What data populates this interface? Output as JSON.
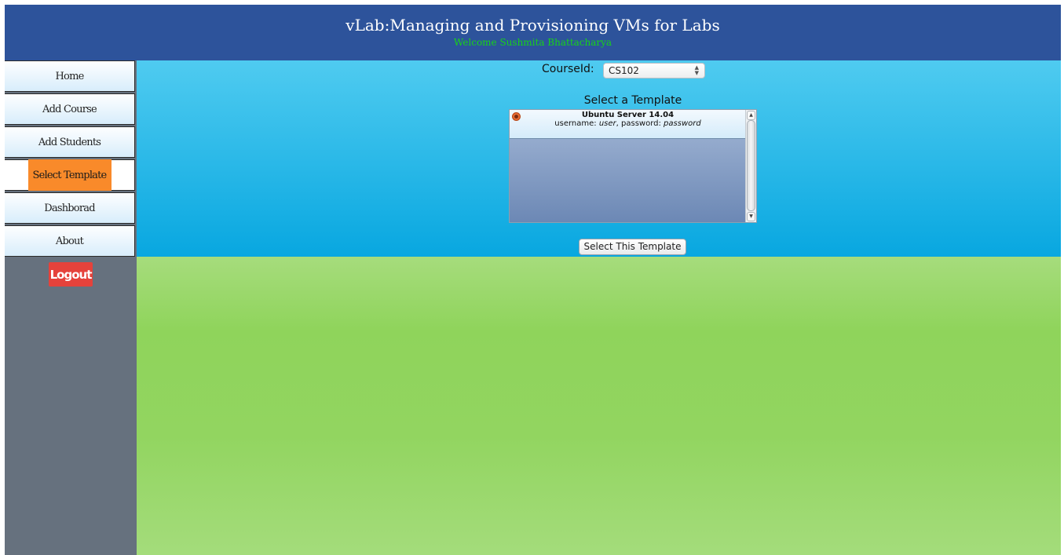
{
  "header": {
    "title": "vLab:Managing and Provisioning VMs for Labs",
    "welcome": "Welcome Sushmita Bhattacharya"
  },
  "sidebar": {
    "items": [
      {
        "label": "Home"
      },
      {
        "label": "Add Course"
      },
      {
        "label": "Add Students"
      },
      {
        "label": "Select Template",
        "active": true
      },
      {
        "label": "Dashborad"
      },
      {
        "label": "About"
      }
    ],
    "logout_label": "Logout"
  },
  "main": {
    "course_label": "CourseId:",
    "course_selected": "CS102",
    "template_heading": "Select a Template",
    "templates": [
      {
        "name": "Ubuntu Server 14.04",
        "cred_prefix": "username: ",
        "username": "user",
        "cred_mid": ", password: ",
        "password": "password",
        "selected": true
      }
    ],
    "select_button_label": "Select This Template"
  },
  "colors": {
    "header_bg": "#2d539b",
    "welcome_text": "#17d417",
    "sidebar_bg": "#66717e",
    "active_nav": "#f98a2a",
    "logout_bg": "#e5423b",
    "top_panel": "#29b8e8",
    "bottom_panel": "#92d560"
  }
}
